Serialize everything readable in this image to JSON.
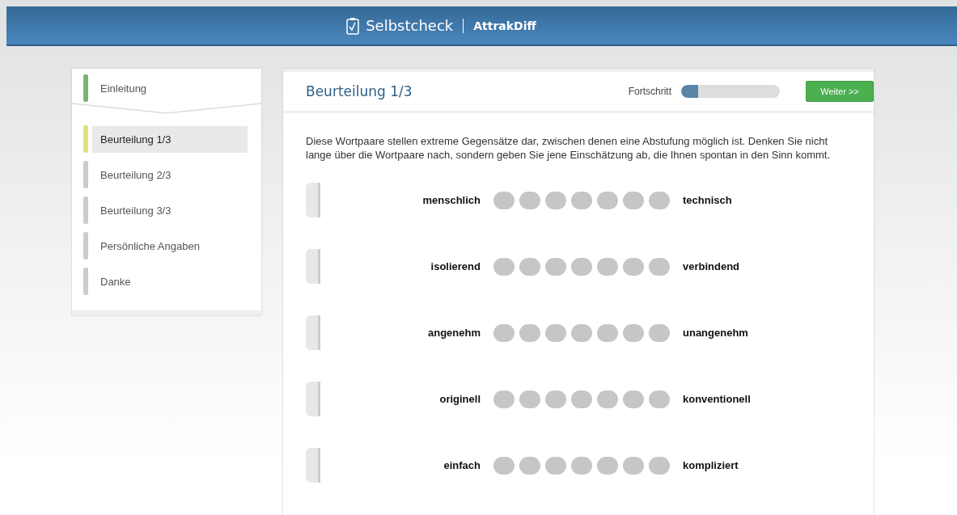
{
  "header": {
    "brand": "Selbstcheck",
    "product": "AttrakDiff"
  },
  "sidebar": {
    "items": [
      {
        "label": "Einleitung",
        "selected": false,
        "color": "#7cb36f"
      },
      {
        "label": "Beurteilung 1/3",
        "selected": true,
        "color": "#e0e083"
      },
      {
        "label": "Beurteilung 2/3",
        "selected": false,
        "color": "#cccccc"
      },
      {
        "label": "Beurteilung 3/3",
        "selected": false,
        "color": "#cccccc"
      },
      {
        "label": "Persönliche Angaben",
        "selected": false,
        "color": "#cccccc"
      },
      {
        "label": "Danke",
        "selected": false,
        "color": "#cccccc"
      }
    ]
  },
  "main": {
    "title": "Beurteilung 1/3",
    "progress": {
      "label": "Fortschritt",
      "level": 0.17
    },
    "next_button": "Weiter >>",
    "instructions": "Diese Wortpaare stellen extreme Gegensätze dar, zwischen denen eine Abstufung möglich ist. Denken Sie nicht lange über die Wortpaare nach, sondern geben Sie jene Einschätzung ab, die Ihnen spontan in den Sinn kommt.",
    "pairs": [
      {
        "left": "menschlich",
        "right": "technisch",
        "options": [
          false,
          false,
          false,
          false,
          false,
          false,
          false
        ]
      },
      {
        "left": "isolierend",
        "right": "verbindend",
        "options": [
          false,
          false,
          false,
          false,
          false,
          false,
          false
        ]
      },
      {
        "left": "angenehm",
        "right": "unangenehm",
        "options": [
          false,
          false,
          false,
          false,
          false,
          false,
          false
        ]
      },
      {
        "left": "originell",
        "right": "konventionell",
        "options": [
          false,
          false,
          false,
          false,
          false,
          false,
          false
        ]
      },
      {
        "left": "einfach",
        "right": "kompliziert",
        "options": [
          false,
          false,
          false,
          false,
          false,
          false,
          false
        ]
      }
    ]
  }
}
